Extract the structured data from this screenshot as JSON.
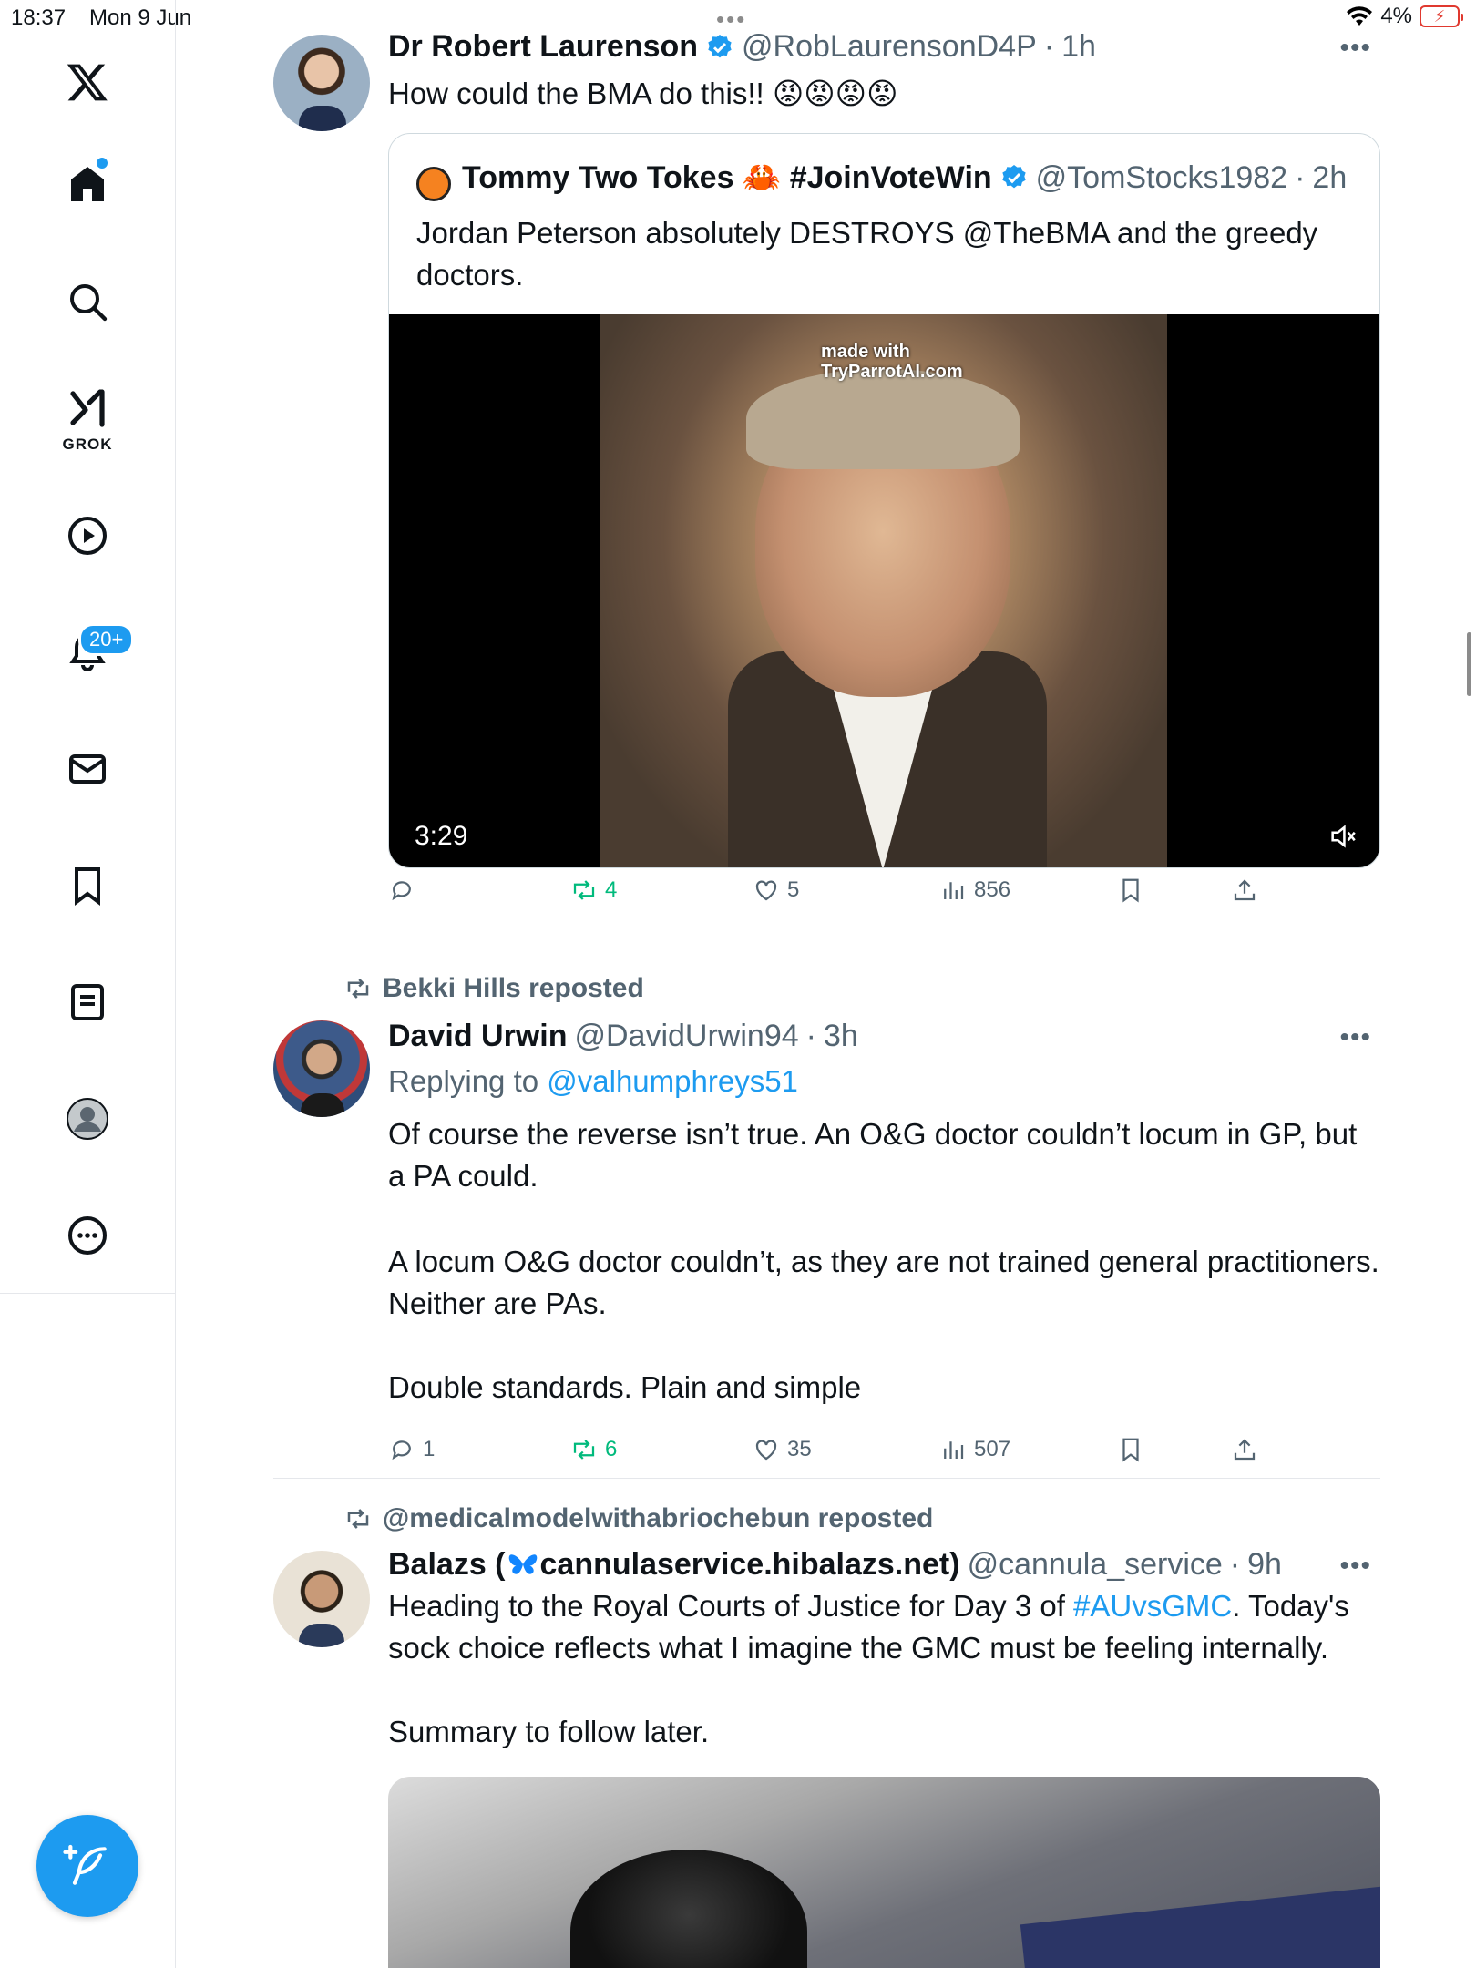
{
  "status": {
    "time": "18:37",
    "date": "Mon 9 Jun",
    "battery": "4%"
  },
  "sidebar": {
    "grok_label": "GROK",
    "notifications_badge": "20+"
  },
  "tweets": [
    {
      "name": "Dr Robert Laurenson",
      "handle": "@RobLaurensonD4P",
      "time": "1h",
      "text": "How could the BMA do this!! 😡😡😡😡",
      "quote": {
        "name": "Tommy Two Tokes 🦀 #JoinVoteWin",
        "handle": "@TomStocks1982",
        "time": "2h",
        "text": "Jordan Peterson absolutely DESTROYS @TheBMA and the greedy doctors.",
        "video_duration": "3:29",
        "watermark_line1": "made with",
        "watermark_line2": "TryParrotAI.com"
      },
      "stats": {
        "replies": "",
        "reposts": "4",
        "likes": "5",
        "views": "856"
      }
    },
    {
      "reposted_by": "Bekki Hills reposted",
      "name": "David Urwin",
      "handle": "@DavidUrwin94",
      "time": "3h",
      "replying_prefix": "Replying to ",
      "replying_to": "@valhumphreys51",
      "paragraph1": "Of course the reverse isn’t true. An O&G doctor couldn’t locum in GP, but a PA could.",
      "paragraph2": "A locum O&G doctor couldn’t, as they are not trained general practitioners. Neither are PAs.",
      "paragraph3": "Double standards. Plain and simple",
      "stats": {
        "replies": "1",
        "reposts": "6",
        "likes": "35",
        "views": "507"
      }
    },
    {
      "reposted_by": "@medicalmodelwithabriochebun reposted",
      "name_prefix": "Balazs (",
      "name_suffix": "cannulaservice.hibalazs.net)",
      "handle": "@cannula_service",
      "time": "9h",
      "text_before": "Heading to the Royal Courts of Justice for Day 3 of ",
      "hashtag": "#AUvsGMC",
      "text_after": ". Today's sock choice reflects what I imagine the GMC must be feeling internally.",
      "paragraph2": "Summary to follow later."
    }
  ],
  "colors": {
    "accent": "#1d9bf0",
    "repost_green": "#00ba7c",
    "muted": "#536471"
  }
}
